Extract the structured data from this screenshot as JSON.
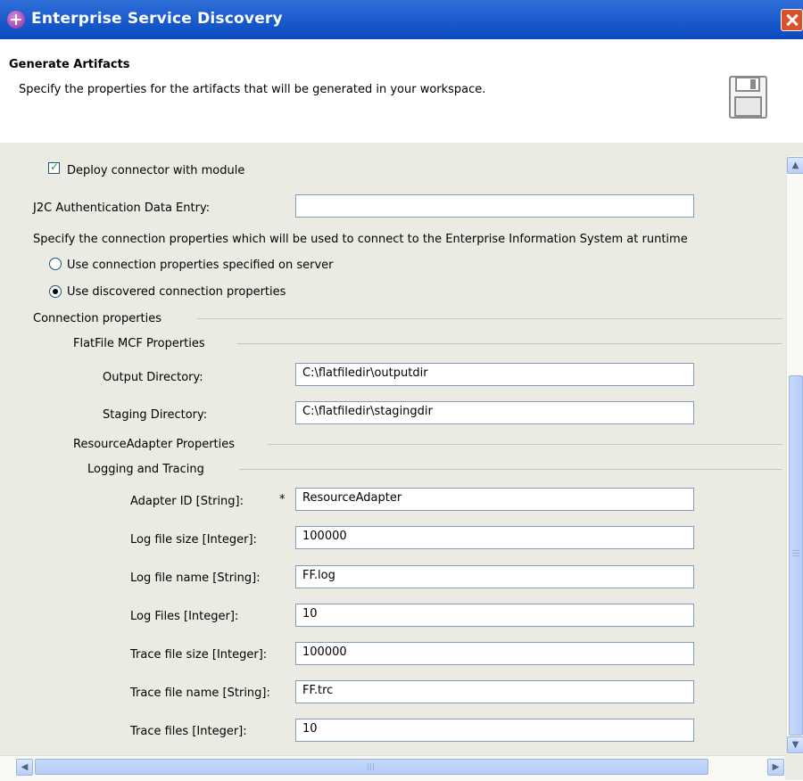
{
  "window": {
    "title": "Enterprise Service Discovery"
  },
  "header": {
    "title": "Generate Artifacts",
    "description": "Specify the properties for the artifacts that will be generated in your workspace.",
    "icon": "floppy-disk-icon"
  },
  "form": {
    "deploy_label": "Deploy connector with module",
    "deploy_checked": true,
    "j2c_label": "J2C Authentication Data Entry:",
    "j2c_value": "",
    "conn_instruction": "Specify the connection properties which will be used to connect to the Enterprise Information System at runtime",
    "radio_server_label": "Use connection properties specified on server",
    "radio_discovered_label": "Use discovered connection properties",
    "radio_selected": "discovered",
    "connection_properties_label": "Connection properties",
    "mcf_group_label": "FlatFile MCF Properties",
    "output_dir_label": "Output Directory:",
    "output_dir_value": "C:\\flatfiledir\\outputdir",
    "staging_dir_label": "Staging Directory:",
    "staging_dir_value": "C:\\flatfiledir\\stagingdir",
    "ra_group_label": "ResourceAdapter Properties",
    "logging_group_label": "Logging and Tracing",
    "required_marker": "*",
    "fields": [
      {
        "label": "Adapter ID [String]:",
        "value": "ResourceAdapter"
      },
      {
        "label": "Log file size [Integer]:",
        "value": "100000"
      },
      {
        "label": "Log file name [String]:",
        "value": "FF.log"
      },
      {
        "label": "Log Files [Integer]:",
        "value": "10"
      },
      {
        "label": "Trace file size [Integer]:",
        "value": "100000"
      },
      {
        "label": "Trace file name [String]:",
        "value": "FF.trc"
      },
      {
        "label": "Trace files [Integer]:",
        "value": "10"
      }
    ]
  },
  "scrollbars": {
    "vertical_position": 0.45,
    "horizontal_position": 0.0
  }
}
